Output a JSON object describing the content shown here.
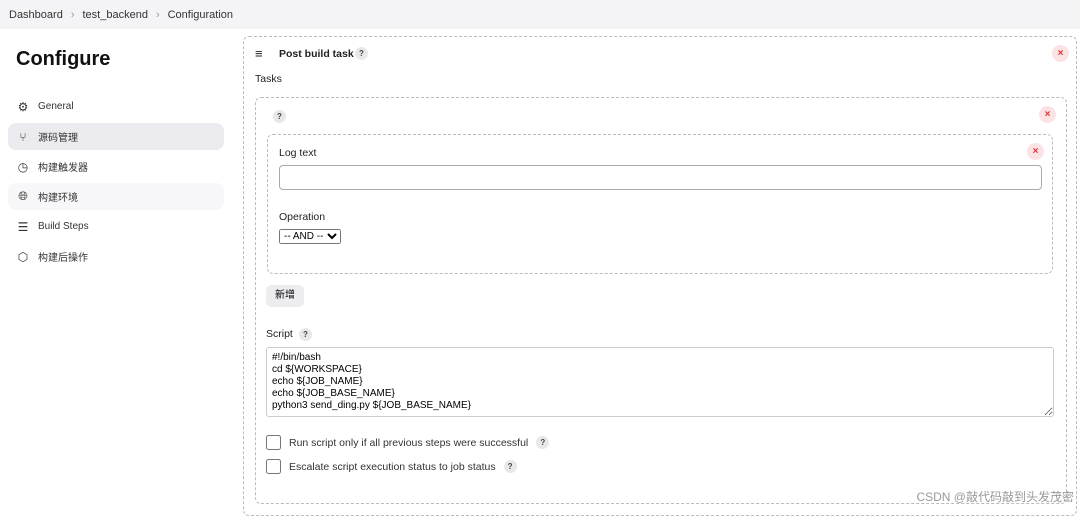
{
  "breadcrumb": [
    "Dashboard",
    "test_backend",
    "Configuration"
  ],
  "sidebar": {
    "title": "Configure",
    "items": [
      {
        "label": "General",
        "icon": "gear-icon"
      },
      {
        "label": "源码管理",
        "icon": "branch-icon"
      },
      {
        "label": "构建触发器",
        "icon": "clock-icon"
      },
      {
        "label": "构建环境",
        "icon": "globe-icon"
      },
      {
        "label": "Build Steps",
        "icon": "list-icon"
      },
      {
        "label": "构建后操作",
        "icon": "package-icon"
      }
    ]
  },
  "section": {
    "title": "Post build task",
    "tasks_label": "Tasks",
    "log_text_label": "Log text",
    "log_text_value": "",
    "operation_label": "Operation",
    "operation_value": "-- AND --",
    "add_label": "新增",
    "script_label": "Script",
    "script": "#!/bin/bash\ncd ${WORKSPACE}\necho ${JOB_NAME}\necho ${JOB_BASE_NAME}\npython3 send_ding.py ${JOB_BASE_NAME}",
    "run_only_success": "Run script only if all previous steps were successful",
    "escalate": "Escalate script execution status to job status",
    "help": "?",
    "close": "×"
  },
  "watermark": "CSDN @敲代码敲到头发茂密"
}
